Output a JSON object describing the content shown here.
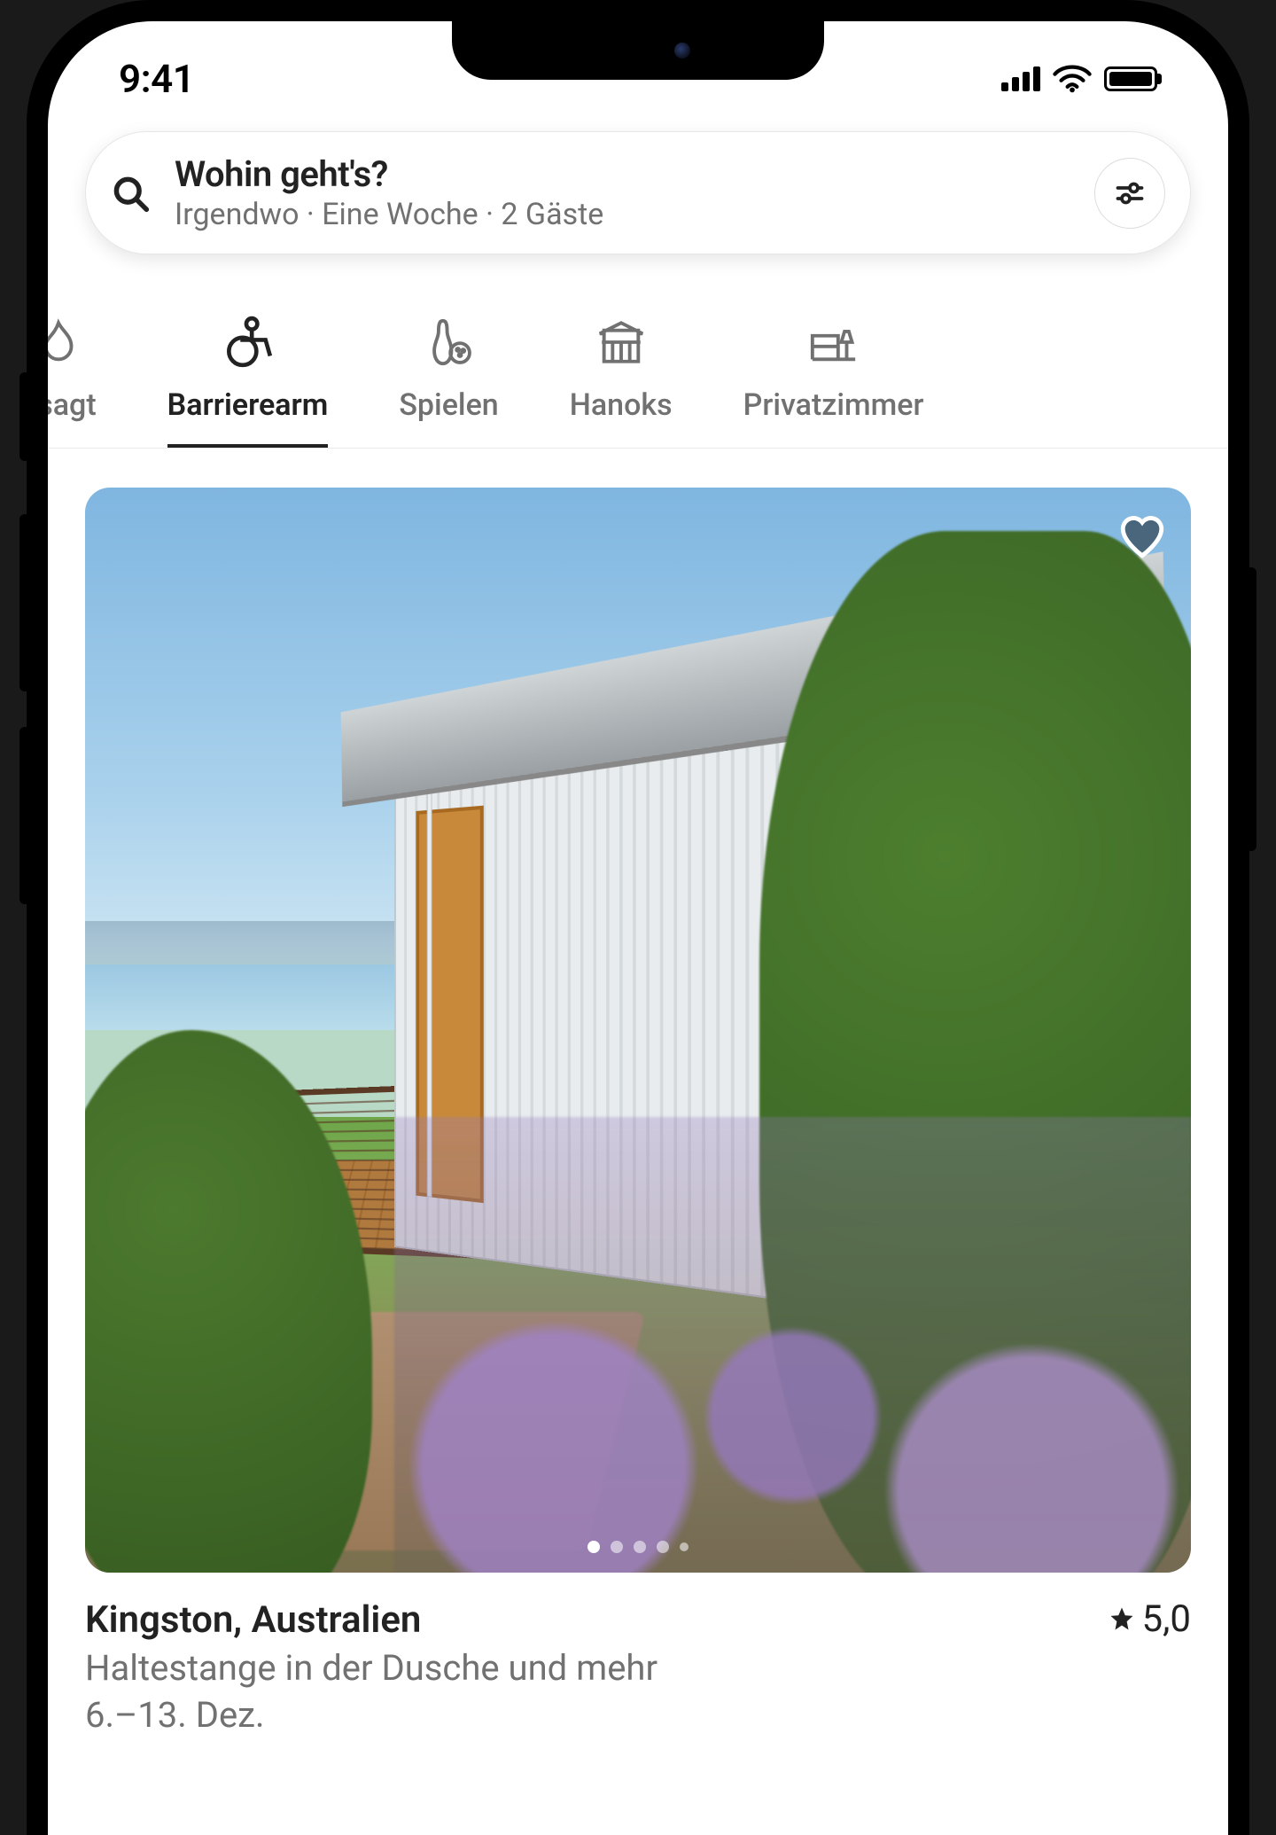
{
  "status": {
    "time": "9:41"
  },
  "search": {
    "title": "Wohin geht's?",
    "subtitle": "Irgendwo · Eine Woche · 2 Gäste"
  },
  "categories": [
    {
      "id": "angesagt",
      "label": "esagt",
      "active": false
    },
    {
      "id": "barrierearm",
      "label": "Barrierearm",
      "active": true
    },
    {
      "id": "spielen",
      "label": "Spielen",
      "active": false
    },
    {
      "id": "hanoks",
      "label": "Hanoks",
      "active": false
    },
    {
      "id": "privatzimmer",
      "label": "Privatzimmer",
      "active": false
    }
  ],
  "listing": {
    "location": "Kingston, Australien",
    "rating": "5,0",
    "feature": "Haltestange in der Dusche und mehr",
    "dates": "6.–13. Dez.",
    "image_dots": 5,
    "active_dot": 0
  }
}
